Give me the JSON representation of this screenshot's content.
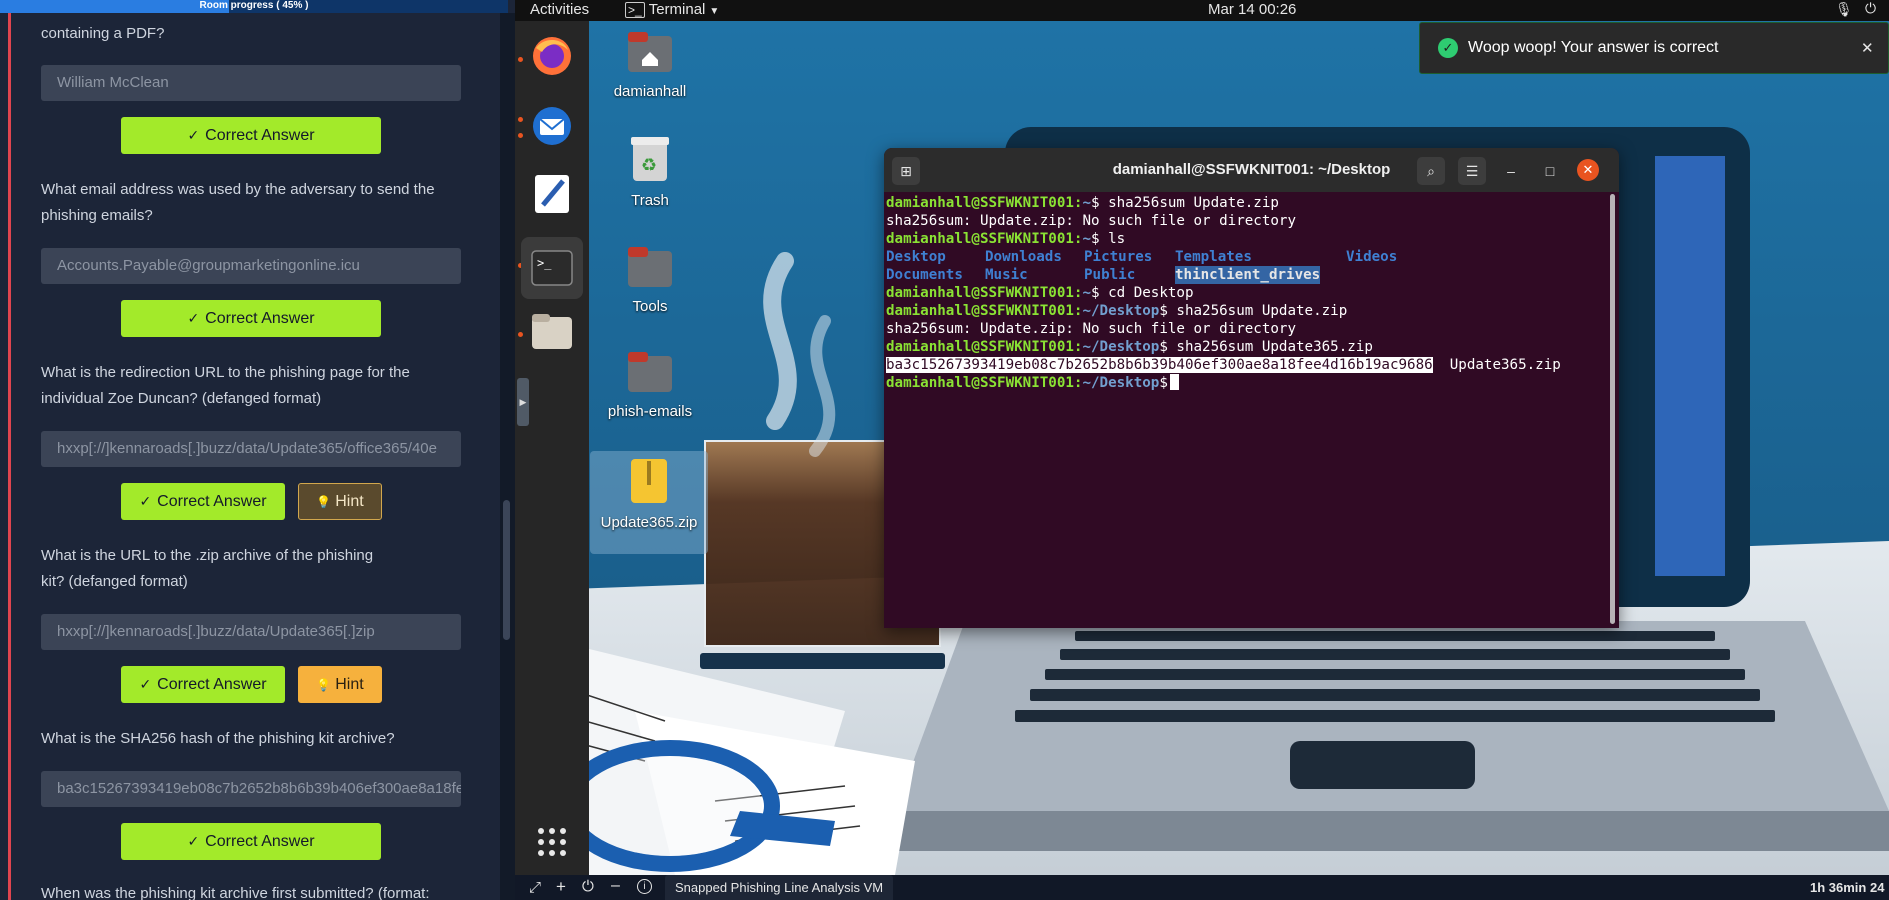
{
  "progress": {
    "text": "Room progress ( 45% )",
    "value_percent": 45
  },
  "questions": [
    {
      "text": "containing a PDF?",
      "answer": "William McClean",
      "correct_label": "Correct Answer",
      "hint_label": null
    },
    {
      "text_line1": "What email address was used by the adversary to send the",
      "text_line2": "phishing emails?",
      "answer": "Accounts.Payable@groupmarketingonline.icu",
      "correct_label": "Correct Answer",
      "hint_label": null
    },
    {
      "text_line1": "What is the redirection URL to the phishing page for the",
      "text_line2": "individual Zoe Duncan? (defanged format)",
      "answer": "hxxp[://]kennaroads[.]buzz/data/Update365/office365/40e",
      "correct_label": "Correct Answer",
      "hint_label": "Hint"
    },
    {
      "text_line1": "What is the URL to the .zip archive of the phishing",
      "text_line2": "kit? (defanged format)",
      "answer": "hxxp[://]kennaroads[.]buzz/data/Update365[.]zip",
      "correct_label": "Correct Answer",
      "hint_label": "Hint"
    },
    {
      "text_line1": "What is the SHA256 hash of the phishing kit archive?",
      "answer": "ba3c15267393419eb08c7b2652b8b6b39b406ef300ae8a18fe",
      "correct_label": "Correct Answer",
      "hint_label": null
    },
    {
      "text_line1": "When was the phishing kit archive first submitted? (format:"
    }
  ],
  "topbar": {
    "activities": "Activities",
    "app": "Terminal",
    "datetime": "Mar 14  00:26"
  },
  "desktop_icons": [
    "damianhall",
    "Trash",
    "Tools",
    "phish-emails",
    "Update365.zip"
  ],
  "terminal": {
    "title": "damianhall@SSFWKNIT001: ~/Desktop",
    "user_host": "damianhall@SSFWKNIT001",
    "lines": {
      "l1_path": "~",
      "l1_cmd": "$ sha256sum Update.zip",
      "l2": "sha256sum: Update.zip: No such file or directory",
      "l3_path": "~",
      "l3_cmd": "$ ls",
      "ls_desktop": "Desktop",
      "ls_downloads": "Downloads",
      "ls_pictures": "Pictures",
      "ls_templates": "Templates",
      "ls_videos": "Videos",
      "ls_documents": "Documents",
      "ls_music": "Music",
      "ls_public": "Public",
      "ls_thinclient": "thinclient_drives",
      "l6_path": "~",
      "l6_cmd": "$ cd Desktop",
      "l7_path": "~/Desktop",
      "l7_cmd": "$ sha256sum Update.zip",
      "l8": "sha256sum: Update.zip: No such file or directory",
      "l9_path": "~/Desktop",
      "l9_cmd": "$ sha256sum Update365.zip",
      "hash": "ba3c15267393419eb08c7b2652b8b6b39b406ef300ae8a18fee4d16b19ac9686",
      "hash_file": "Update365.zip",
      "l11_path": "~/Desktop",
      "l11_cmd": "$"
    }
  },
  "toast": {
    "message": "Woop woop! Your answer is correct"
  },
  "bottombar": {
    "vm_label": "Snapped Phishing Line Analysis VM",
    "timer": "1h 36min 24"
  },
  "colors": {
    "correct_green": "#a3ea2a",
    "hint_orange": "#f6b13d",
    "progress_blue": "#2a7de1",
    "terminal_bg": "#300a24",
    "prompt_green": "#8ae234",
    "prompt_blue": "#729fcf"
  },
  "icons": [
    "check-icon",
    "bulb-icon",
    "firefox-icon",
    "thunderbird-icon",
    "text-editor-icon",
    "terminal-icon",
    "files-icon",
    "app-grid-icon",
    "home-folder-icon",
    "trash-icon",
    "folder-icon",
    "zip-icon",
    "search-icon",
    "menu-icon",
    "new-tab-icon",
    "minimize-icon",
    "maximize-icon",
    "close-icon",
    "success-icon",
    "mic-icon",
    "power-icon",
    "info-icon",
    "fullscreen-icon",
    "plus-icon"
  ]
}
